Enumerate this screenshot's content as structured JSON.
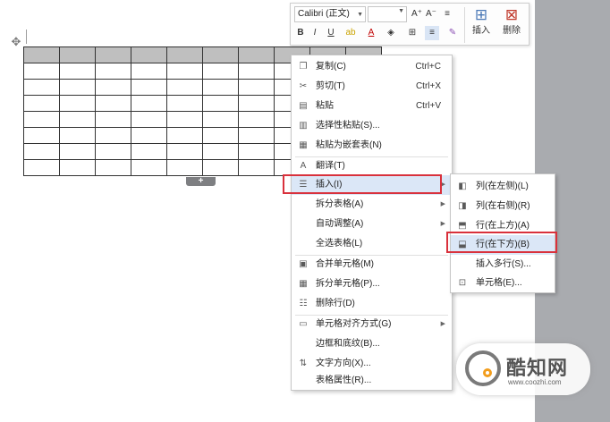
{
  "toolbar": {
    "font_name": "Calibri (正文)",
    "font_size": "",
    "buttons_row1": [
      "A⁺",
      "A⁻",
      "≡"
    ],
    "buttons_row2": [
      "B",
      "I",
      "U",
      "ab",
      "A",
      "◈",
      "⊞",
      "≡",
      "✎"
    ],
    "insert_label": "插入",
    "delete_label": "删除"
  },
  "table_add_glyph": "+",
  "move_glyph": "✥",
  "context_menu": {
    "items": [
      {
        "label": "复制(C)",
        "shortcut": "Ctrl+C",
        "icon": "copy-icon"
      },
      {
        "label": "剪切(T)",
        "shortcut": "Ctrl+X",
        "icon": "cut-icon"
      },
      {
        "label": "粘贴",
        "shortcut": "Ctrl+V",
        "icon": "paste-icon"
      },
      {
        "label": "选择性粘贴(S)...",
        "shortcut": "",
        "icon": "paste-special-icon"
      },
      {
        "label": "粘贴为嵌套表(N)",
        "shortcut": "",
        "icon": "paste-nested-icon"
      },
      {
        "label": "翻译(T)",
        "shortcut": "",
        "icon": "translate-icon"
      },
      {
        "label": "插入(I)",
        "shortcut": "",
        "icon": "insert-table-icon"
      },
      {
        "label": "拆分表格(A)",
        "shortcut": "",
        "icon": ""
      },
      {
        "label": "自动调整(A)",
        "shortcut": "",
        "icon": ""
      },
      {
        "label": "全选表格(L)",
        "shortcut": "",
        "icon": ""
      },
      {
        "label": "合并单元格(M)",
        "shortcut": "",
        "icon": "merge-cells-icon"
      },
      {
        "label": "拆分单元格(P)...",
        "shortcut": "",
        "icon": "split-cells-icon"
      },
      {
        "label": "删除行(D)",
        "shortcut": "",
        "icon": "delete-row-icon"
      },
      {
        "label": "单元格对齐方式(G)",
        "shortcut": "",
        "icon": "cell-align-icon"
      },
      {
        "label": "边框和底纹(B)...",
        "shortcut": "",
        "icon": ""
      },
      {
        "label": "文字方向(X)...",
        "shortcut": "",
        "icon": "text-direction-icon"
      },
      {
        "label": "表格属性(R)...",
        "shortcut": "",
        "icon": ""
      }
    ]
  },
  "insert_submenu": {
    "items": [
      {
        "label": "列(在左侧)(L)",
        "icon": "insert-col-left-icon"
      },
      {
        "label": "列(在右侧)(R)",
        "icon": "insert-col-right-icon"
      },
      {
        "label": "行(在上方)(A)",
        "icon": "insert-row-above-icon"
      },
      {
        "label": "行(在下方)(B)",
        "icon": "insert-row-below-icon"
      },
      {
        "label": "插入多行(S)...",
        "icon": ""
      },
      {
        "label": "单元格(E)...",
        "icon": "insert-cell-icon"
      }
    ]
  },
  "watermark": {
    "name": "酷知网",
    "url": "www.coozhi.com"
  },
  "colors": {
    "highlight": "#dbe7f7",
    "red_box": "#d9313c",
    "header_row": "#bfbfbf",
    "side_strip": "#a9abaf"
  }
}
